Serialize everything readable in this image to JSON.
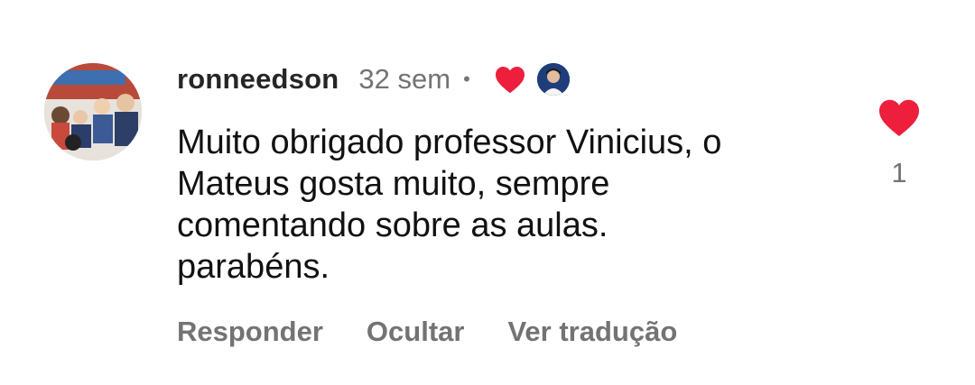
{
  "comment": {
    "username": "ronneedson",
    "time_ago": "32 sem",
    "separator": "•",
    "text_lines": [
      "Muito obrigado professor Vinicius, o",
      "Mateus gosta muito, sempre",
      "comentando sobre as aulas.",
      "parabéns."
    ],
    "like_count": "1",
    "creator_liked": true
  },
  "actions": {
    "reply": "Responder",
    "hide": "Ocultar",
    "translate": "Ver tradução"
  },
  "colors": {
    "heart": "#ed1f3c",
    "username": "#262626",
    "secondary": "#737373"
  },
  "icons": {
    "liked_by_creator": "heart-icon",
    "like_button": "heart-icon"
  }
}
